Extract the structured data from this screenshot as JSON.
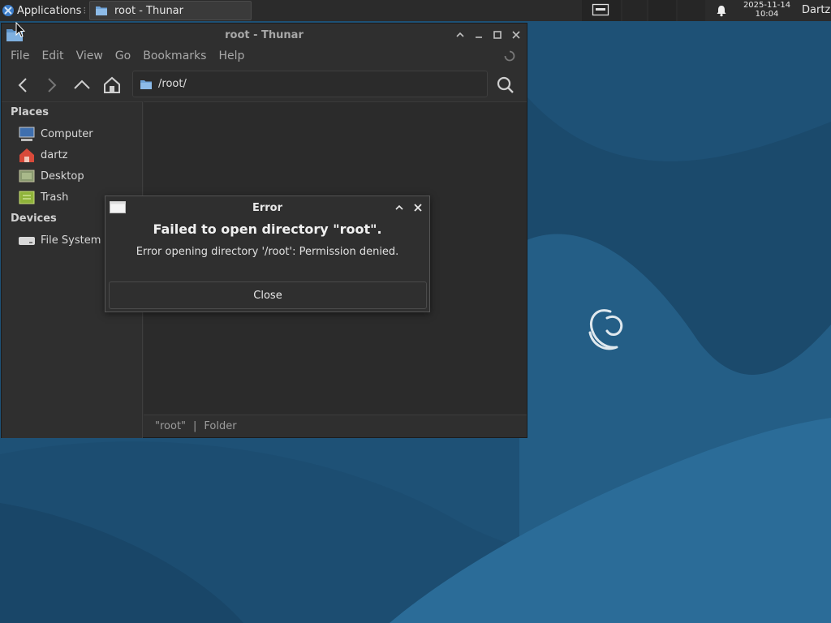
{
  "panel": {
    "applications_label": "Applications",
    "separator": "⁝",
    "task_label": "root - Thunar",
    "clock_date": "2025-11-14",
    "clock_time": "10:04",
    "user": "Dartz"
  },
  "window": {
    "title": "root - Thunar",
    "menu": [
      "File",
      "Edit",
      "View",
      "Go",
      "Bookmarks",
      "Help"
    ],
    "path": "/root/",
    "sidebar": {
      "places_heading": "Places",
      "places": [
        "Computer",
        "dartz",
        "Desktop",
        "Trash"
      ],
      "devices_heading": "Devices",
      "devices": [
        "File System"
      ]
    },
    "status": {
      "name": "\"root\"",
      "separator": "|",
      "type": "Folder"
    }
  },
  "dialog": {
    "title": "Error",
    "heading": "Failed to open directory \"root\".",
    "message": "Error opening directory '/root': Permission denied.",
    "close_label": "Close"
  },
  "colors": {
    "desktop_dark": "#1a4a6e",
    "desktop_light": "#2a6a96",
    "panel": "#2b2b2b",
    "window": "#2f2f2f"
  },
  "icons": [
    "xfce-logo-icon",
    "folder-icon",
    "keyboard-icon",
    "bell-icon",
    "spinner-icon",
    "back-icon",
    "forward-icon",
    "up-icon",
    "home-icon",
    "search-icon",
    "computer-icon",
    "home-folder-icon",
    "desktop-icon",
    "trash-icon",
    "drive-icon",
    "window-icon",
    "cursor-icon"
  ]
}
